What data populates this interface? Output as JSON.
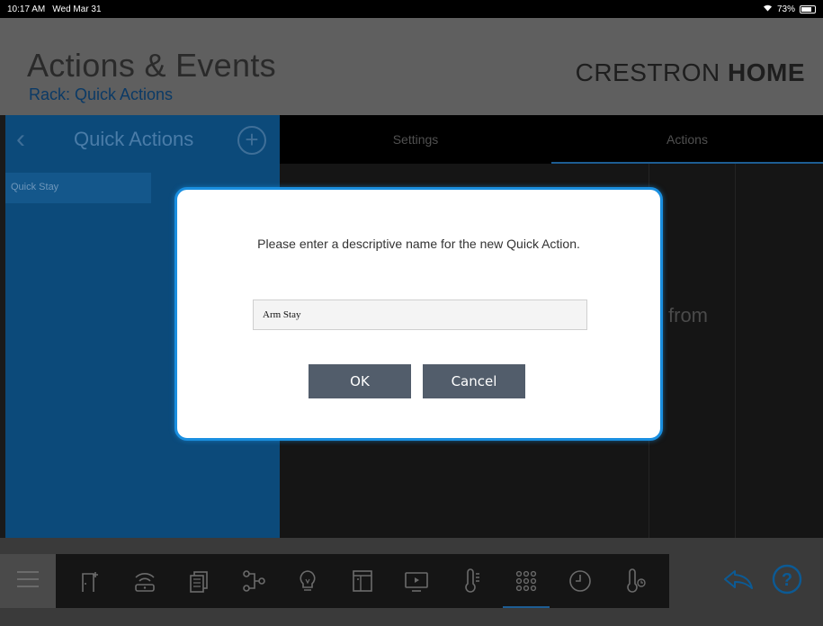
{
  "status": {
    "time": "10:17 AM",
    "date": "Wed Mar 31",
    "battery": "73%"
  },
  "header": {
    "title": "Actions & Events",
    "subtitle": "Rack: Quick Actions",
    "brand_light": "CRESTRON",
    "brand_bold": "HOME"
  },
  "left_panel": {
    "title": "Quick Actions",
    "items": [
      {
        "label": "Quick Stay"
      }
    ]
  },
  "tabs": [
    {
      "label": "Settings",
      "active": false
    },
    {
      "label": "Actions",
      "active": true
    }
  ],
  "background_text": "from",
  "dialog": {
    "message": "Please enter a descriptive name for the new Quick Action.",
    "input_value": "Arm Stay",
    "ok_label": "OK",
    "cancel_label": "Cancel"
  },
  "bottom_nav": {
    "icons": [
      "menu-icon",
      "door-icon",
      "wifi-speaker-icon",
      "shades-icon",
      "flow-icon",
      "lightbulb-icon",
      "window-icon",
      "tv-icon",
      "thermometer-icon",
      "keypad-icon",
      "clock-icon",
      "climate-icon"
    ],
    "active_icon": "keypad-icon"
  },
  "colors": {
    "accent": "#1a8fe0",
    "panel_blue": "#0c4a7a",
    "button": "#525d6b"
  }
}
